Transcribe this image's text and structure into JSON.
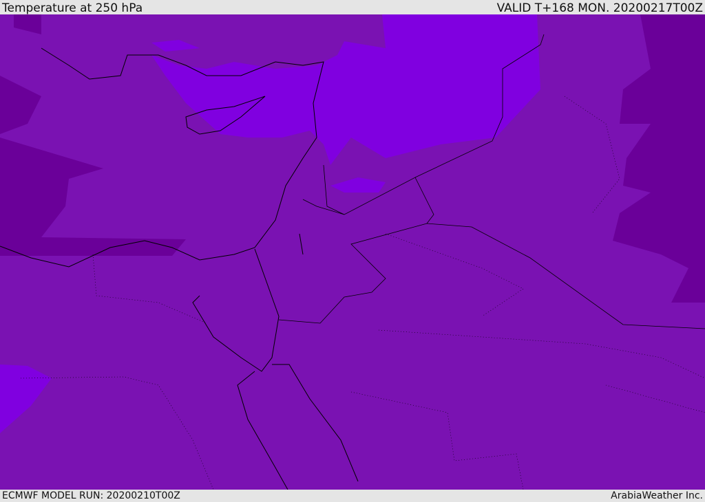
{
  "header": {
    "title": "Temperature at 250 hPa",
    "valid": "VALID T+168 MON. 20200217T00Z"
  },
  "footer": {
    "model_run": "ECMWF MODEL RUN: 20200210T00Z",
    "credit": "ArabiaWeather Inc."
  },
  "colors": {
    "base": "#7a12b2",
    "warm": "#8000e0",
    "cold": "#6a0099",
    "coast": "#000000"
  }
}
